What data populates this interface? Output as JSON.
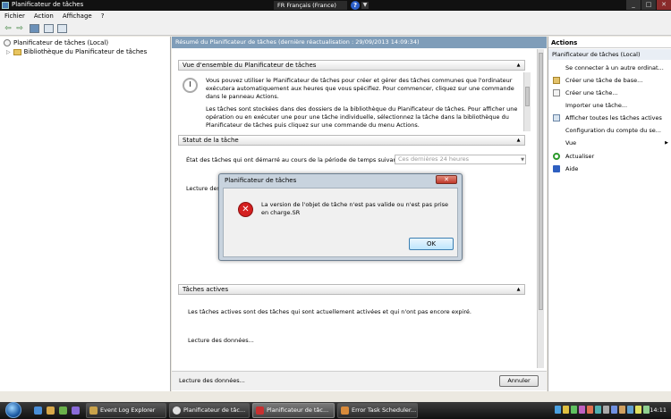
{
  "window": {
    "title": "Planificateur de tâches"
  },
  "language_bar": {
    "label": "FR Français (France)",
    "help_label": "?",
    "dropdown_label": "▼"
  },
  "window_controls": {
    "minimize": "_",
    "maximize": "□",
    "close": "✕"
  },
  "menubar": {
    "items": [
      "Fichier",
      "Action",
      "Affichage",
      "?"
    ]
  },
  "toolbar": {
    "back": "⇦",
    "forward": "⇨"
  },
  "tree": {
    "root": "Planificateur de tâches (Local)",
    "child": "Bibliothèque du Planificateur de tâches",
    "expander": "▷"
  },
  "center": {
    "summary_header": "Résumé du Planificateur de tâches (dernière réactualisation : 29/09/2013 14:09:34)",
    "overview": {
      "title": "Vue d'ensemble du Planificateur de tâches",
      "para1": "Vous pouvez utiliser le Planificateur de tâches pour créer et gérer des tâches communes que l'ordinateur exécutera automatiquement aux heures que vous spécifiez. Pour commencer, cliquez sur une commande dans le panneau Actions.",
      "para2": "Les tâches sont stockées dans des dossiers de la bibliothèque du Planificateur de tâches. Pour afficher une opération ou en exécuter une pour une tâche individuelle, sélectionnez la tâche dans la bibliothèque du Planificateur de tâches puis cliquez sur une commande du menu Actions."
    },
    "status": {
      "title": "Statut de la tâche",
      "label": "État des tâches qui ont démarré au cours de la période de temps suivante :",
      "select_value": "Ces dernières 24 heures",
      "reading": "Lecture des"
    },
    "active": {
      "title": "Tâches actives",
      "text": "Les tâches actives sont des tâches qui sont actuellement activées et qui n'ont pas encore expiré.",
      "reading": "Lecture des données..."
    },
    "collapse": "▲",
    "footer": {
      "status": "Lecture des données...",
      "cancel": "Annuler"
    }
  },
  "actions": {
    "header": "Actions",
    "subheader": "Planificateur de tâches (Local)",
    "items": [
      "Se connecter à un autre ordinat...",
      "Créer une tâche de base...",
      "Créer une tâche...",
      "Importer une tâche...",
      "Afficher toutes les tâches actives",
      "Configuration du compte du se...",
      "Vue",
      "Actualiser",
      "Aide"
    ],
    "submenu_arrow": "▶"
  },
  "dialog": {
    "title": "Planificateur de tâches",
    "close": "✕",
    "icon": "✕",
    "message": "La version de l'objet de tâche n'est pas valide ou n'est pas prise en charge.SR",
    "ok": "OK"
  },
  "taskbar": {
    "items": [
      "Event Log Explorer",
      "Planificateur de tâc...",
      "Planificateur de tâc...",
      "Error Task Scheduler..."
    ],
    "clock": "14:11"
  },
  "colors": {
    "accent": "#7f9db9",
    "error": "#d42020"
  }
}
